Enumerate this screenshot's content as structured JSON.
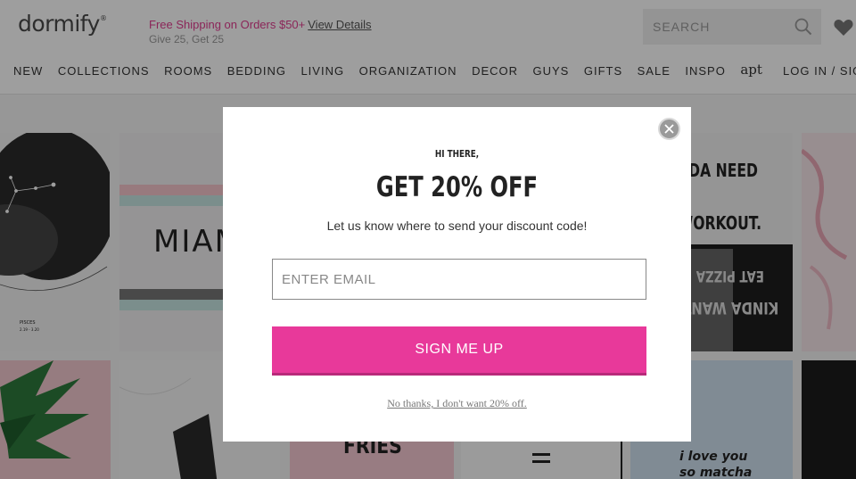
{
  "header": {
    "logo": "dormify",
    "logo_mark": "®",
    "promo_main": "Free Shipping on Orders $50+",
    "promo_link": "View Details",
    "promo_sub": "Give 25, Get 25",
    "search_placeholder": "SEARCH",
    "search_icon": "search-icon",
    "wishlist_icon": "heart-icon"
  },
  "nav": {
    "items": [
      "NEW",
      "COLLECTIONS",
      "ROOMS",
      "BEDDING",
      "LIVING",
      "ORGANIZATION",
      "DECOR",
      "GUYS",
      "GIFTS",
      "SALE",
      "INSPO"
    ],
    "apt_label": "apt",
    "login_label": "LOG IN / SIGN"
  },
  "grid_tiles": {
    "pisces_label": "PISCES",
    "pisces_date": "2.19 - 3.20",
    "miami_label": "MIAMI",
    "workout_line1": "I KINDA NEED",
    "workout_line2": "A WORKOUT.",
    "workout_mirror1": "EAT PIZZA",
    "workout_mirror2": "KINDA WANT",
    "fries_label": "FRIES",
    "love_line1": "i love you",
    "love_line2": "so matcha"
  },
  "modal": {
    "greeting": "HI THERE,",
    "title": "GET 20% OFF",
    "subtitle": "Let us know where to send your discount code!",
    "email_placeholder": "ENTER EMAIL",
    "email_value": "",
    "submit_label": "SIGN ME UP",
    "decline_label": "No thanks, I don't want 20% off.",
    "close_icon": "close-icon"
  },
  "colors": {
    "accent_pink": "#e8399a",
    "promo_pink": "#e03c8f",
    "overlay": "rgba(0,0,0,0.38)"
  }
}
